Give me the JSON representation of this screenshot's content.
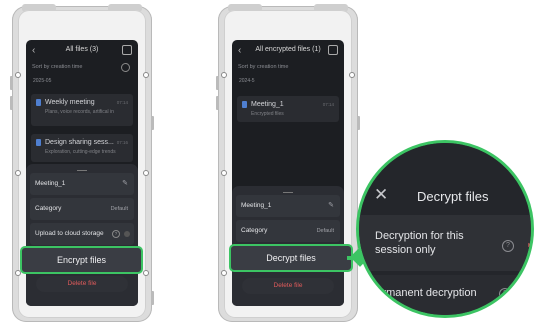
{
  "left_phone": {
    "header_title": "All files (3)",
    "sort_label": "Sort by creation time",
    "date_header": "2025-05",
    "cards": [
      {
        "title": "Weekly meeting",
        "subtitle": "Plans, voice records, artifical in",
        "time": "07:14",
        "sub2": "08.21"
      },
      {
        "title": "Design sharing sess...",
        "subtitle": "Exploration, cutting-edge trends",
        "time": "07:16",
        "sub2": ""
      }
    ],
    "sheet": {
      "file_name": "Meeting_1",
      "category_label": "Category",
      "category_value": "Default",
      "upload_label": "Upload to cloud storage",
      "encrypt_label": "Encrypt files",
      "delete_label": "Delete file"
    }
  },
  "right_phone": {
    "header_title": "All encrypted files (1)",
    "sort_label": "Sort by creation time",
    "date_header": "2024-5",
    "card": {
      "title": "Meeting_1",
      "subtitle": "Encrypted files",
      "time": "07:14"
    },
    "sheet": {
      "file_name": "Meeting_1",
      "category_label": "Category",
      "category_value": "Default",
      "decrypt_label": "Decrypt files",
      "delete_label": "Delete file"
    }
  },
  "callout": {
    "title": "Decrypt files",
    "option1": "Decryption for this session only",
    "option2": "Permanent decryption"
  },
  "icons": {
    "back": "chevron-left-icon",
    "select": "checkbox-icon",
    "search": "search-icon",
    "file": "document-icon",
    "edit": "pencil-icon",
    "help": "question-circle-icon",
    "close": "close-icon"
  },
  "colors": {
    "highlight": "#3cc463",
    "delete": "#e05b5b",
    "screen_bg": "#1c1e22"
  }
}
